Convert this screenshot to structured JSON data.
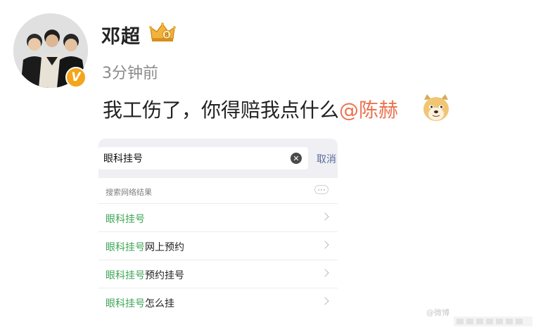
{
  "post": {
    "username": "邓超",
    "timestamp": "3分钟前",
    "text": "我工伤了，你得赔我点什么",
    "mention": "@陈赫",
    "verified_badge": "V",
    "badge_icon": "crown-icon",
    "emoji_icon": "doge-icon"
  },
  "embedded_screenshot": {
    "search_query": "眼科挂号",
    "cancel_label": "取消",
    "section_label": "搜索网络结果",
    "suggestions": [
      {
        "highlight": "眼科挂号",
        "rest": ""
      },
      {
        "highlight": "眼科挂号",
        "rest": "网上预约"
      },
      {
        "highlight": "眼科挂号",
        "rest": "预约挂号"
      },
      {
        "highlight": "眼科挂号",
        "rest": "怎么挂"
      }
    ]
  },
  "watermark": "@微博"
}
